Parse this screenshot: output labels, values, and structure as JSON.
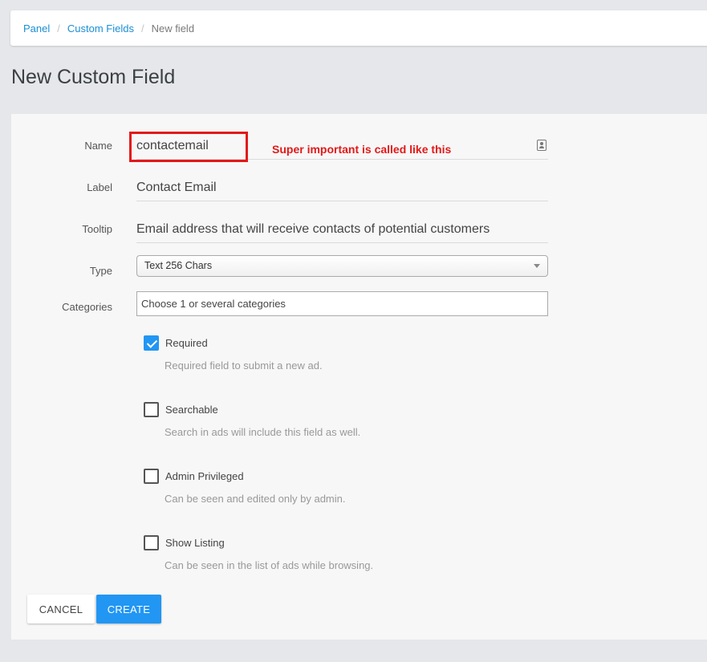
{
  "breadcrumb": {
    "items": [
      {
        "label": "Panel"
      },
      {
        "label": "Custom Fields"
      }
    ],
    "current": "New field",
    "separator": "/"
  },
  "page": {
    "title": "New Custom Field"
  },
  "form": {
    "name": {
      "label": "Name",
      "value": "contactemail"
    },
    "annotation": "Super important is called like this",
    "label_field": {
      "label": "Label",
      "value": "Contact Email"
    },
    "tooltip": {
      "label": "Tooltip",
      "value": "Email address that will receive contacts of potential customers"
    },
    "type": {
      "label": "Type",
      "selected": "Text 256 Chars"
    },
    "categories": {
      "label": "Categories",
      "placeholder": "Choose 1 or several categories"
    },
    "checkboxes": [
      {
        "label": "Required",
        "help": "Required field to submit a new ad.",
        "checked": true
      },
      {
        "label": "Searchable",
        "help": "Search in ads will include this field as well.",
        "checked": false
      },
      {
        "label": "Admin Privileged",
        "help": "Can be seen and edited only by admin.",
        "checked": false
      },
      {
        "label": "Show Listing",
        "help": "Can be seen in the list of ads while browsing.",
        "checked": false
      }
    ]
  },
  "buttons": {
    "cancel": "CANCEL",
    "create": "CREATE"
  },
  "colors": {
    "accent": "#2196f3",
    "link": "#1a8fd6",
    "annotation": "#e31919"
  },
  "icons": {
    "name_field_icon": "contact-card-icon",
    "select_caret": "caret-down-icon",
    "check_mark": "checkmark-icon"
  }
}
